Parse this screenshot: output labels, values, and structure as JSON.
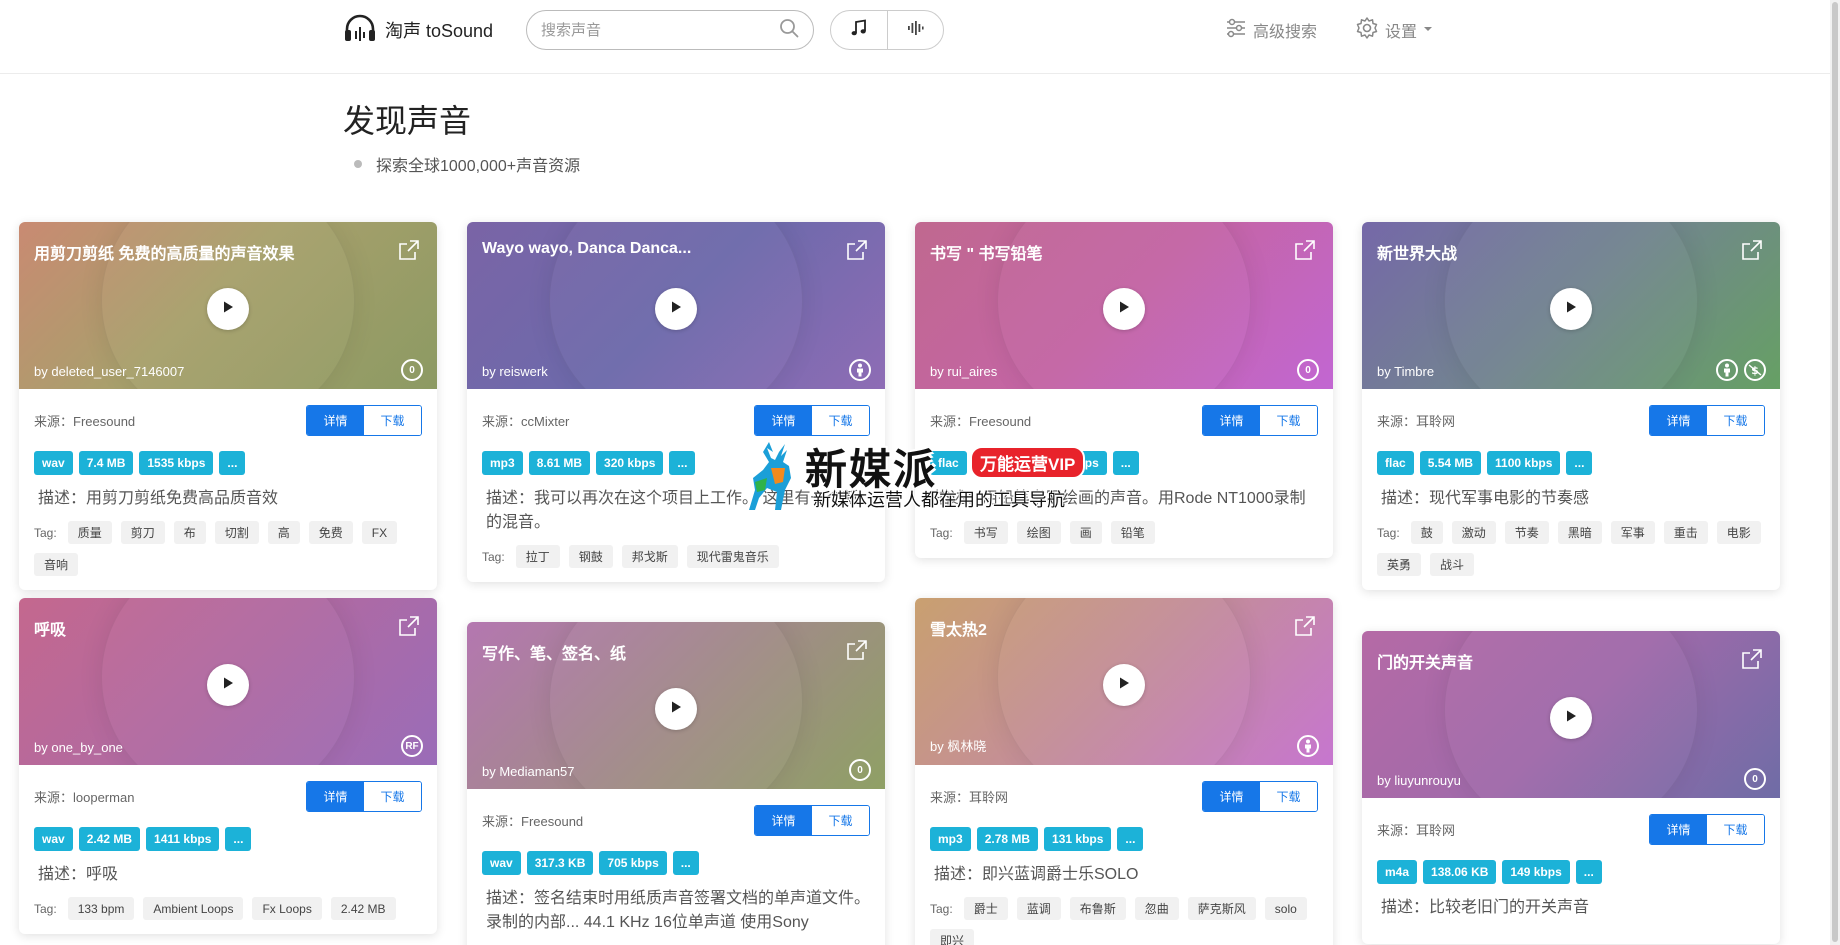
{
  "header": {
    "logo_text": "淘声 toSound",
    "search_placeholder": "搜索声音",
    "advanced_search": "高级搜索",
    "settings": "设置"
  },
  "hero": {
    "title": "发现声音",
    "subtitle": "探索全球1000,000+声音资源"
  },
  "labels": {
    "detail": "详情",
    "download": "下载",
    "more": "...",
    "tag": "Tag:"
  },
  "watermark": {
    "brand": "新媒派",
    "vip": "万能运营VIP",
    "slogan": "新媒体运营人都在用的工具导航"
  },
  "cards": [
    {
      "title": "用剪刀剪纸 免费的高质量的声音效果",
      "by": "by deleted_user_7146007",
      "source": "来源：Freesound",
      "format": "wav",
      "size": "7.4 MB",
      "bitrate": "1535 kbps",
      "license": [
        "0"
      ],
      "desc": "描述：用剪刀剪纸免费高品质音效",
      "tags": [
        "质量",
        "剪刀",
        "布",
        "切割",
        "高",
        "免费",
        "FX",
        "音响"
      ],
      "gradient": "linear-gradient(135deg,#c98a72 0%,#a8a06c 45%,#8c9a63 100%)"
    },
    {
      "title": "Wayo wayo, Danca Danca...",
      "by": "by reiswerk",
      "source": "来源：ccMixter",
      "format": "mp3",
      "size": "8.61 MB",
      "bitrate": "320 kbps",
      "license": [
        "by"
      ],
      "desc": "描述：我可以再次在这个项目上工作。 这里有一个新的混音。",
      "tags": [
        "拉丁",
        "钢鼓",
        "邦戈斯",
        "现代雷鬼音乐"
      ],
      "gradient": "linear-gradient(135deg,#7a64a6 0%,#6d6aab 50%,#8e6cb5 100%)"
    },
    {
      "title": "书写 \" 书写铅笔",
      "by": "by rui_aires",
      "source": "来源：Freesound",
      "format": "flac",
      "size": "3.1 MB",
      "bitrate": "1411 kbps",
      "license": [
        "0"
      ],
      "desc": "描述：用铅笔书写绘画的声音。用Rode NT1000录制",
      "tags": [
        "书写",
        "绘图",
        "画",
        "铅笔"
      ],
      "gradient": "linear-gradient(135deg,#c0688f 0%,#c465a5 50%,#c266d2 100%)"
    },
    {
      "title": "新世界大战",
      "by": "by Timbre",
      "source": "来源：耳聆网",
      "format": "flac",
      "size": "5.54 MB",
      "bitrate": "1100 kbps",
      "license": [
        "by",
        "nc"
      ],
      "desc": "描述：现代军事电影的节奏感",
      "tags": [
        "鼓",
        "激动",
        "节奏",
        "黑暗",
        "军事",
        "重击",
        "电影",
        "英勇",
        "战斗"
      ],
      "gradient": "linear-gradient(135deg,#7568a8 0%,#72858f 50%,#66a064 100%)"
    },
    {
      "title": "呼吸",
      "by": "by one_by_one",
      "source": "来源：looperman",
      "format": "wav",
      "size": "2.42 MB",
      "bitrate": "1411 kbps",
      "license": [
        "RF"
      ],
      "desc": "描述：呼吸",
      "tags": [
        "133 bpm",
        "Ambient Loops",
        "Fx Loops",
        "2.42 MB"
      ],
      "gradient": "linear-gradient(135deg,#c4688e 0%,#b06aa2 50%,#9a6cb8 100%)"
    },
    {
      "title": "写作、笔、签名、纸",
      "by": "by Mediaman57",
      "source": "来源：Freesound",
      "format": "wav",
      "size": "317.3 KB",
      "bitrate": "705 kbps",
      "license": [
        "0"
      ],
      "desc": "描述：签名结束时用纸质声音签署文档的单声道文件。录制的内部... 44.1 KHz 16位单声道 使用Sony",
      "tags": [],
      "gradient": "linear-gradient(135deg,#b477b0 0%,#a28a8a 50%,#8fa065 100%)"
    },
    {
      "title": "雪太热2",
      "by": "by 枫林晓",
      "source": "来源：耳聆网",
      "format": "mp3",
      "size": "2.78 MB",
      "bitrate": "131 kbps",
      "license": [
        "by"
      ],
      "desc": "描述：即兴蓝调爵士乐SOLO",
      "tags": [
        "爵士",
        "蓝调",
        "布鲁斯",
        "忽曲",
        "萨克斯风",
        "solo",
        "即兴"
      ],
      "gradient": "linear-gradient(135deg,#c9a070 0%,#c48d9a 50%,#c676cf 100%)"
    },
    {
      "title": "门的开关声音",
      "by": "by liuyunrouyu",
      "source": "来源：耳聆网",
      "format": "m4a",
      "size": "138.06 KB",
      "bitrate": "149 kbps",
      "license": [
        "0"
      ],
      "desc": "描述：比较老旧门的开关声音",
      "tags": [],
      "gradient": "linear-gradient(135deg,#b56aa6 0%,#a06aaa 50%,#6f6ca6 100%)"
    }
  ]
}
